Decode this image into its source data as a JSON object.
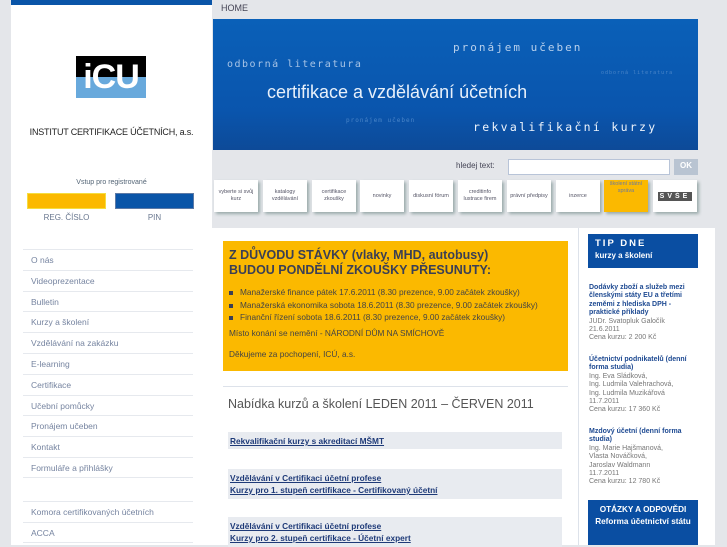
{
  "breadcrumb": "HOME",
  "logo": {
    "text": "iCU",
    "institute": "INSTITUT CERTIFIKACE ÚČETNÍCH, a.s."
  },
  "login": {
    "title": "Vstup pro registrované",
    "reg_label": "REG. ČÍSLO",
    "pin_label": "PIN"
  },
  "menu": [
    "O nás",
    "Videoprezentace",
    "Bulletin",
    "Kurzy a školení",
    "Vzdělávání na zakázku",
    "E-learning",
    "Certifikace",
    "Učební pomůcky",
    "Pronájem učeben",
    "Kontakt",
    "Formuláře a přihlášky"
  ],
  "menu2": [
    "Komora certifikovaných účetních",
    "ACCA"
  ],
  "banner": {
    "t1": "pronájem učeben",
    "t2": "odborná literatura",
    "t3": "odborná literatura",
    "main": "certifikace a vzdělávání účetních",
    "t4": "pronájem učeben",
    "t5": "rekvalifikační kurzy"
  },
  "search": {
    "label": "hledej text:",
    "value": "",
    "ok": "OK"
  },
  "tiles": [
    "vyberte si svůj kurz",
    "katalogy vzdělávání",
    "certifikace zkoušky",
    "novinky",
    "diskusní fórum",
    "creditinfo lustrace firem",
    "právní předpisy",
    "inzerce",
    "školení státní správa",
    "SVŠE"
  ],
  "alert": {
    "h1": "Z DŮVODU STÁVKY (vlaky, MHD, autobusy)",
    "h2": "BUDOU PONDĚLNÍ ZKOUŠKY PŘESUNUTY:",
    "items": [
      "Manažerské finance pátek 17.6.2011 (8.30 prezence, 9.00 začátek zkoušky)",
      "Manažerská ekonomika sobota 18.6.2011 (8.30 prezence, 9.00 začátek zkoušky)",
      "Finanční řízení sobota 18.6.2011 (8.30 prezence, 9.00 začátek zkoušky)"
    ],
    "place": "Místo konání se nemění - NÁRODNÍ DŮM NA SMÍCHOVĚ",
    "thanks": "Děkujeme za pochopení, ICÚ, a.s."
  },
  "offer": {
    "title": "Nabídka kurzů a školení LEDEN 2011 – ČERVEN 2011",
    "links": [
      [
        "Rekvalifikační kurzy s akreditací MŠMT"
      ],
      [
        "Vzdělávání v Certifikaci účetní profese",
        "Kurzy pro 1. stupeň certifikace - Certifikovaný účetní"
      ],
      [
        "Vzdělávání v Certifikaci účetní profese",
        "Kurzy pro 2. stupeň certifikace - Účetní expert"
      ]
    ]
  },
  "tip": {
    "title": "TIP DNE",
    "subtitle": "kurzy a školení"
  },
  "courses": [
    {
      "title": "Dodávky zboží a služeb mezi členskými státy EU a třetími zeměmi z hlediska DPH - praktické příklady",
      "lines": [
        "JUDr. Svatopluk Galočík",
        "21.6.2011",
        "Cena kurzu: 2 200 Kč"
      ]
    },
    {
      "title": "Účetnictví podnikatelů (denní forma studia)",
      "lines": [
        "Ing. Eva Sládková,",
        "Ing. Ludmila Valehrachová,",
        "Ing. Ludmila Muzikářová",
        "11.7.2011",
        "Cena kurzu: 17 360 Kč"
      ]
    },
    {
      "title": "Mzdový účetní (denní forma studia)",
      "lines": [
        "Ing. Marie Hajšmanová,",
        "Vlasta Nováčková,",
        "Jaroslav Waldmann",
        "11.7.2011",
        "Cena kurzu: 12 780 Kč"
      ]
    }
  ],
  "qa": {
    "title": "OTÁZKY A ODPOVĚDI",
    "subtitle": "Reforma účetnictví státu"
  }
}
